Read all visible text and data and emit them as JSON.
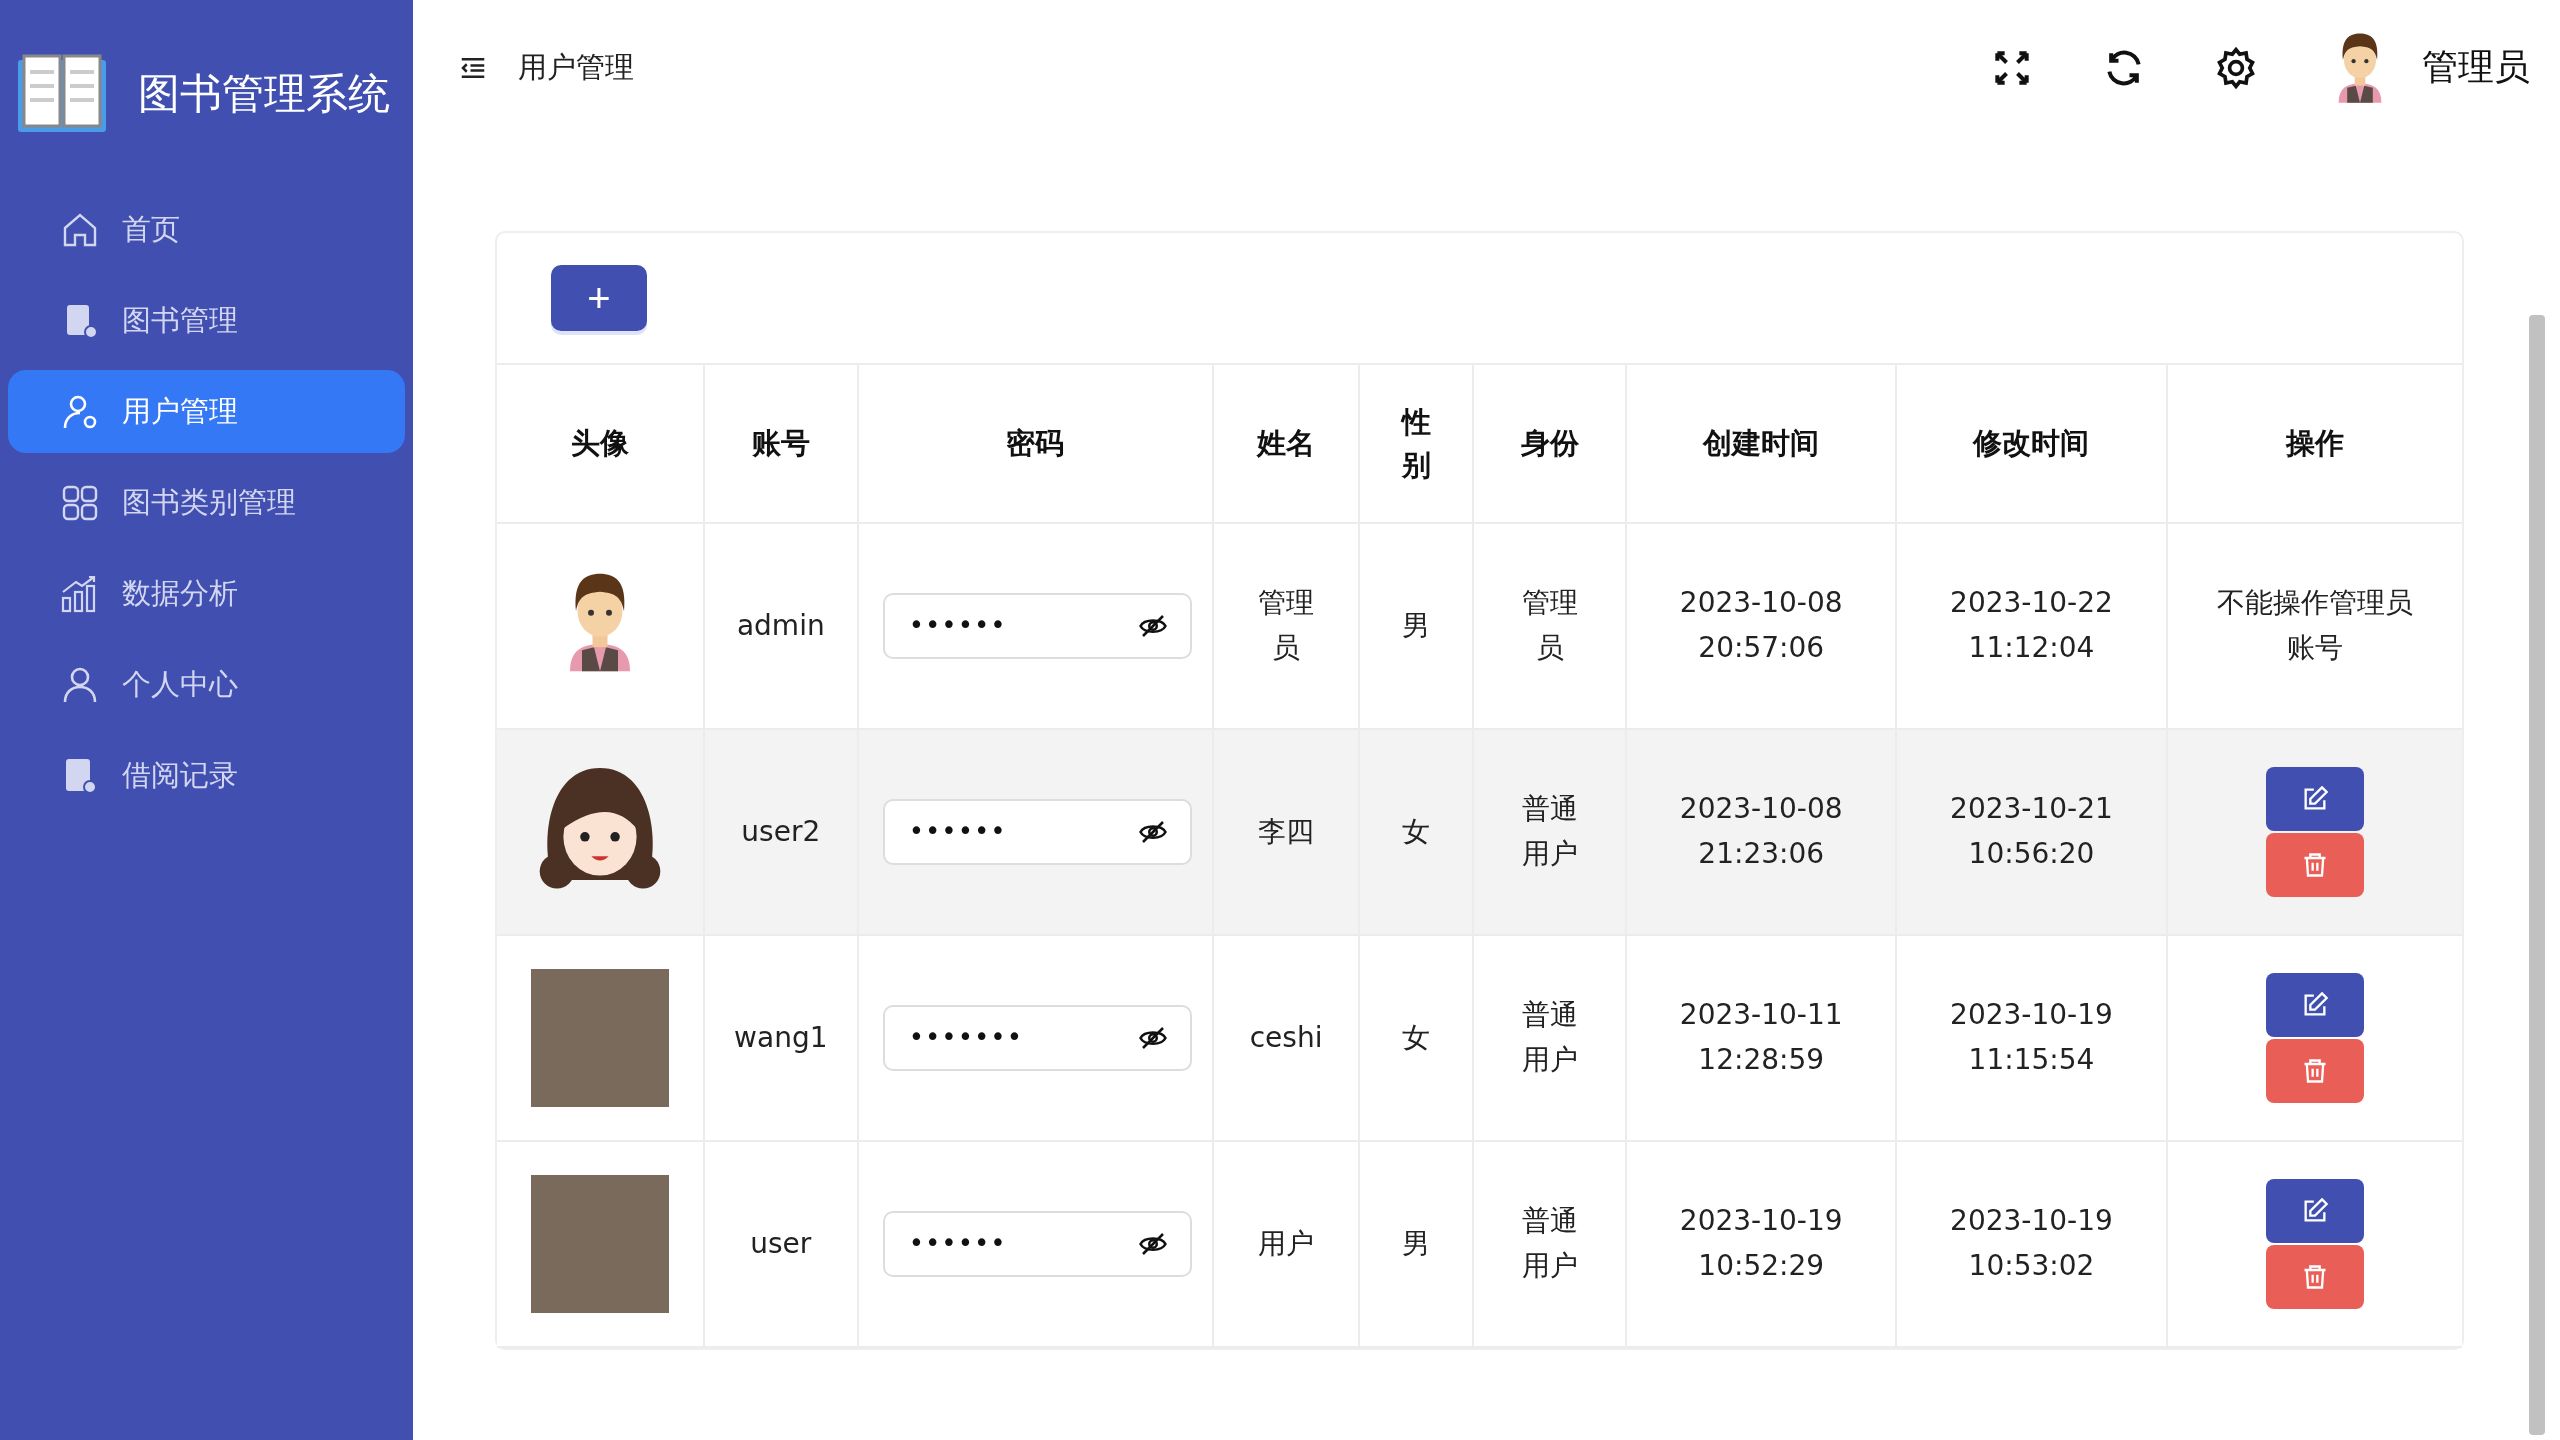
{
  "sidebar": {
    "logo_title": "图书管理系统",
    "items": [
      {
        "label": "首页",
        "selected": false
      },
      {
        "label": "图书管理",
        "selected": false
      },
      {
        "label": "用户管理",
        "selected": true
      },
      {
        "label": "图书类别管理",
        "selected": false
      },
      {
        "label": "数据分析",
        "selected": false
      },
      {
        "label": "个人中心",
        "selected": false
      },
      {
        "label": "借阅记录",
        "selected": false
      }
    ]
  },
  "header": {
    "breadcrumb": "用户管理",
    "user_name": "管理员"
  },
  "add_button": "+",
  "table": {
    "columns": [
      "头像",
      "账号",
      "密码",
      "姓名",
      "性别",
      "身份",
      "创建时间",
      "修改时间",
      "操作"
    ],
    "rows": [
      {
        "avatar": {
          "kind": "man"
        },
        "account": "admin",
        "password": "••••••",
        "name": "管理员",
        "gender": "男",
        "role": "管理员",
        "created": "2023-10-08 20:57:06",
        "modified": "2023-10-22 11:12:04",
        "kind": "locked",
        "note": "不能操作管理员账号",
        "hovered": false
      },
      {
        "avatar": {
          "kind": "woman"
        },
        "account": "user2",
        "password": "••••••",
        "name": "李四",
        "gender": "女",
        "role": "普通用户",
        "created": "2023-10-08 21:23:06",
        "modified": "2023-10-21 10:56:20",
        "kind": "editable",
        "hovered": true
      },
      {
        "avatar": {
          "kind": "photo"
        },
        "account": "wang1",
        "password": "•••••••",
        "name": "ceshi",
        "gender": "女",
        "role": "普通用户",
        "created": "2023-10-11 12:28:59",
        "modified": "2023-10-19 11:15:54",
        "kind": "editable",
        "hovered": false
      },
      {
        "avatar": {
          "kind": "photo"
        },
        "account": "user",
        "password": "••••••",
        "name": "用户",
        "gender": "男",
        "role": "普通用户",
        "created": "2023-10-19 10:52:29",
        "modified": "2023-10-19 10:53:02",
        "kind": "editable",
        "hovered": false
      }
    ]
  }
}
